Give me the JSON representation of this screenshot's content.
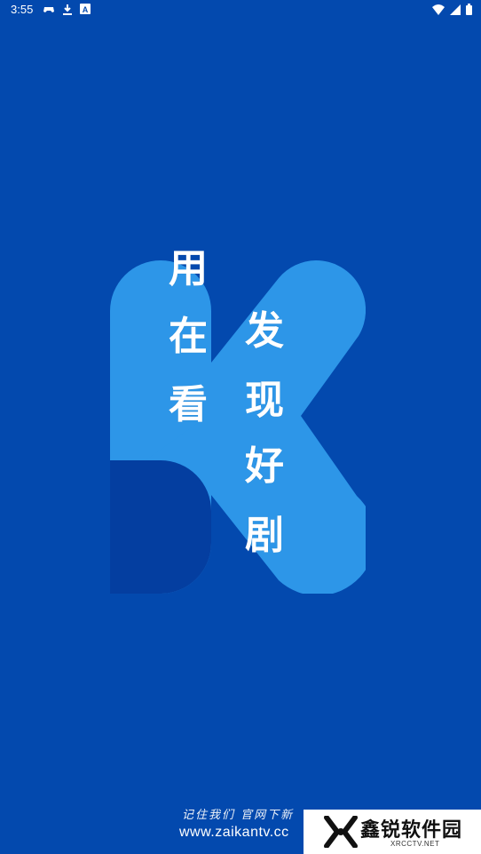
{
  "status_bar": {
    "time": "3:55",
    "left_icons": [
      "game-controller-icon",
      "download-icon",
      "app-a-icon"
    ],
    "right_icons": [
      "wifi-icon",
      "signal-icon",
      "battery-icon"
    ]
  },
  "splash": {
    "slogan_left": [
      "用",
      "在",
      "看"
    ],
    "slogan_right": [
      "发",
      "现",
      "好",
      "剧"
    ],
    "logo_letter": "K"
  },
  "footer": {
    "remember": "记住我们 官网下新",
    "url": "www.zaikantv.cc"
  },
  "watermark": {
    "title": "鑫锐软件园",
    "subtitle": "XRCCTV.NET"
  },
  "colors": {
    "background": "#0349AE",
    "logo_light": "#2D96E8",
    "logo_dark": "#043EA0"
  }
}
